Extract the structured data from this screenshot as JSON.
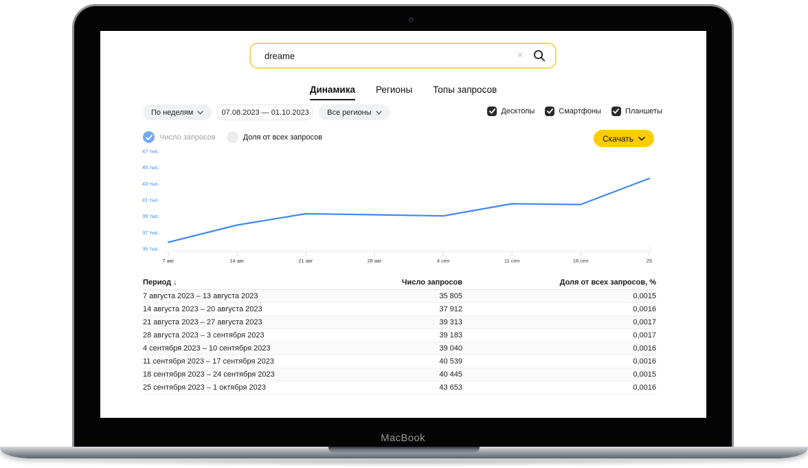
{
  "device": {
    "label": "MacBook"
  },
  "colors": {
    "accent_yellow": "#ffcc00",
    "search_border": "#f6d45e",
    "link_blue": "#3d87f5",
    "checkbox_dark": "#2b2b2b",
    "radio_selected_blue": "#74a8f0"
  },
  "search": {
    "value": "dreame",
    "clear_icon": "×"
  },
  "tabs": [
    {
      "label": "Динамика",
      "active": true
    },
    {
      "label": "Регионы",
      "active": false
    },
    {
      "label": "Топы запросов",
      "active": false
    }
  ],
  "filters": {
    "group_by": "По неделям",
    "date_range": "07.08.2023 — 01.10.2023",
    "region": "Все регионы"
  },
  "device_filters": [
    {
      "label": "Десктопы",
      "checked": true
    },
    {
      "label": "Смартфоны",
      "checked": true
    },
    {
      "label": "Планшеты",
      "checked": true
    }
  ],
  "metric_options": [
    {
      "label": "Число запросов",
      "selected": true
    },
    {
      "label": "Доля от всех запросов",
      "selected": false
    }
  ],
  "download_button": {
    "label": "Скачать"
  },
  "chart_data": {
    "type": "line",
    "title": "",
    "xlabel": "",
    "ylabel": "",
    "x_labels": [
      "7 авг",
      "14 авг",
      "21 авг",
      "28 авг",
      "4 сен",
      "11 сен",
      "18 сен",
      "25"
    ],
    "values": [
      35805,
      37912,
      39313,
      39183,
      39040,
      40539,
      40445,
      43653
    ],
    "ylim": [
      35000,
      47000
    ],
    "ytick_step": 2000,
    "ytick_labels": [
      "35 тыс.",
      "37 тыс.",
      "39 тыс.",
      "41 тыс.",
      "43 тыс.",
      "45 тыс.",
      "47 тыс."
    ],
    "line_color": "#3d87f5",
    "grid": false,
    "legend_position": "none"
  },
  "table": {
    "sort_icon": "↓",
    "columns": [
      "Период",
      "Число запросов",
      "Доля от всех запросов, %"
    ],
    "rows": [
      {
        "period": "7 августа 2023 – 13 августа 2023",
        "queries": "35 805",
        "share": "0,0015"
      },
      {
        "period": "14 августа 2023 – 20 августа 2023",
        "queries": "37 912",
        "share": "0,0016"
      },
      {
        "period": "21 августа 2023 – 27 августа 2023",
        "queries": "39 313",
        "share": "0,0017"
      },
      {
        "period": "28 августа 2023 – 3 сентября 2023",
        "queries": "39 183",
        "share": "0,0017"
      },
      {
        "period": "4 сентября 2023 – 10 сентября 2023",
        "queries": "39 040",
        "share": "0,0016"
      },
      {
        "period": "11 сентября 2023 – 17 сентября 2023",
        "queries": "40 539",
        "share": "0,0016"
      },
      {
        "period": "18 сентября 2023 – 24 сентября 2023",
        "queries": "40 445",
        "share": "0,0015"
      },
      {
        "period": "25 сентября 2023 – 1 октября 2023",
        "queries": "43 653",
        "share": "0,0016"
      }
    ]
  }
}
